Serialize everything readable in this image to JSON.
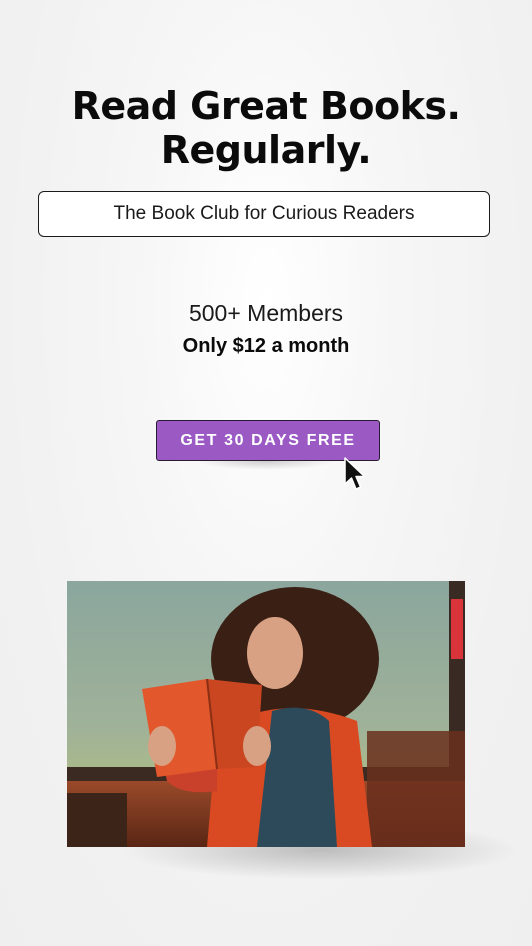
{
  "hero": {
    "headline_line1": "Read Great Books.",
    "headline_line2": "Regularly.",
    "tagline": "The Book Club for Curious Readers"
  },
  "stats": {
    "members": "500+ Members",
    "price": "Only $12 a month"
  },
  "cta": {
    "label": "GET 30 DAYS FREE"
  },
  "colors": {
    "cta_background": "#9b59c4",
    "headline_text": "#0b0b0b"
  },
  "icons": {
    "cursor": "arrow-pointer-icon"
  }
}
